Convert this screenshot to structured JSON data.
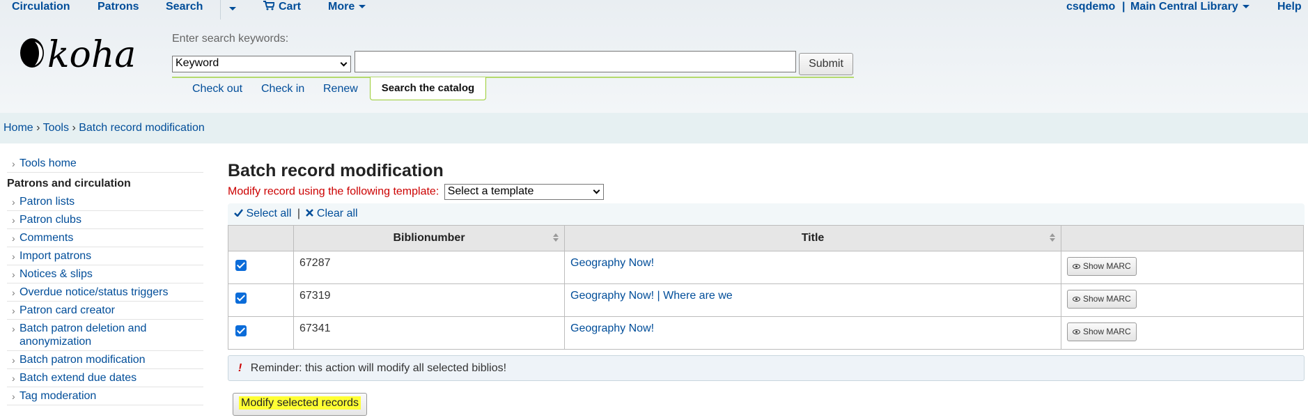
{
  "topnav": {
    "circulation": "Circulation",
    "patrons": "Patrons",
    "search": "Search",
    "cart": "Cart",
    "more": "More",
    "user": "csqdemo",
    "separator": "|",
    "library": "Main Central Library",
    "help": "Help"
  },
  "logo": {
    "text": "koha"
  },
  "search": {
    "hint": "Enter search keywords:",
    "select_value": "Keyword",
    "input_value": "",
    "submit": "Submit"
  },
  "quick_tabs": {
    "check_out": "Check out",
    "check_in": "Check in",
    "renew": "Renew",
    "search_catalog": "Search the catalog"
  },
  "breadcrumb": {
    "home": "Home",
    "tools": "Tools",
    "current": "Batch record modification",
    "sep": "›"
  },
  "sidebar": {
    "tools_home": "Tools home",
    "heading": "Patrons and circulation",
    "items": [
      "Patron lists",
      "Patron clubs",
      "Comments",
      "Import patrons",
      "Notices & slips",
      "Overdue notice/status triggers",
      "Patron card creator",
      "Batch patron deletion and anonymization",
      "Batch patron modification",
      "Batch extend due dates",
      "Tag moderation"
    ]
  },
  "main": {
    "title": "Batch record modification",
    "template_label": "Modify record using the following template:",
    "template_value": "Select a template",
    "select_all": "Select all",
    "pipe": "|",
    "clear_all": "Clear all",
    "columns": [
      "",
      "Biblionumber",
      "Title",
      ""
    ],
    "rows": [
      {
        "biblionumber": "67287",
        "title": "Geography Now!",
        "button": "Show MARC",
        "checked": true
      },
      {
        "biblionumber": "67319",
        "title": "Geography Now! | Where are we",
        "button": "Show MARC",
        "checked": true
      },
      {
        "biblionumber": "67341",
        "title": "Geography Now!",
        "button": "Show MARC",
        "checked": true
      }
    ],
    "reminder_mark": "!",
    "reminder": "Reminder: this action will modify all selected biblios!",
    "modify_button": "Modify selected records"
  },
  "colors": {
    "link": "#004d99",
    "accent_green": "#9acd32",
    "warning_red": "#cc0000",
    "highlight": "#ffff33",
    "checkbox": "#0b6cd9"
  }
}
